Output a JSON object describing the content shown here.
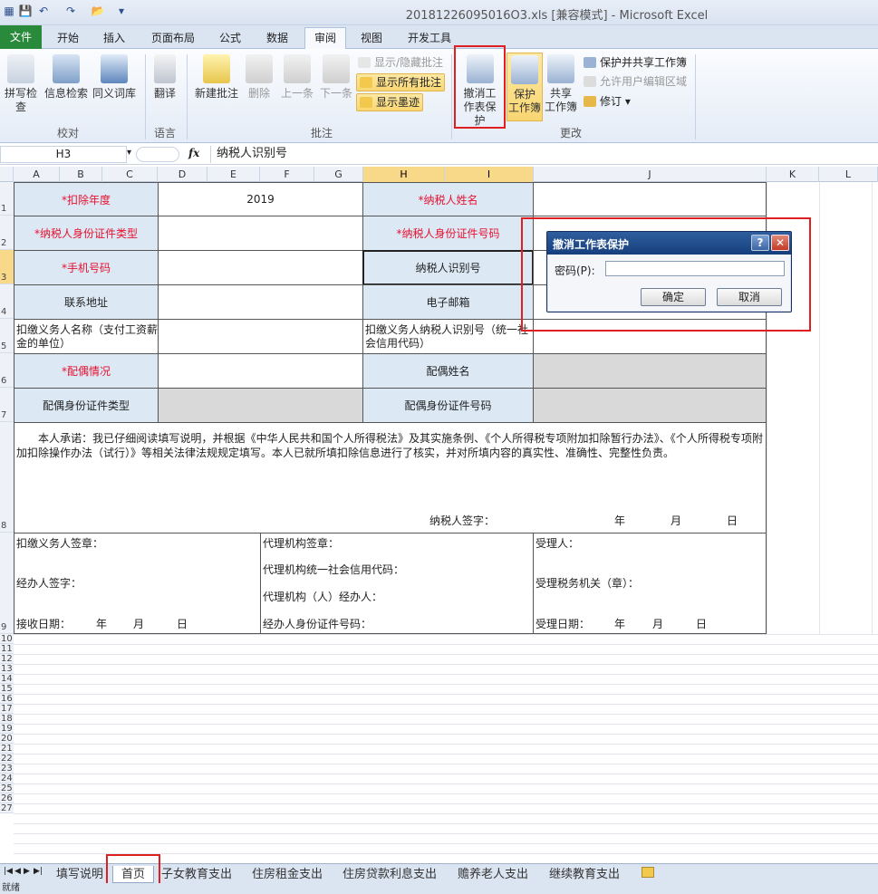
{
  "window": {
    "title": "20181226095016O3.xls  [兼容模式] - Microsoft Excel"
  },
  "menu_tabs": [
    {
      "label": "文件"
    },
    {
      "label": "开始"
    },
    {
      "label": "插入"
    },
    {
      "label": "页面布局"
    },
    {
      "label": "公式"
    },
    {
      "label": "数据"
    },
    {
      "label": "审阅"
    },
    {
      "label": "视图"
    },
    {
      "label": "开发工具"
    }
  ],
  "ribbon": {
    "proofing": {
      "spell": "拼写检查",
      "research": "信息检索",
      "thesaurus": "同义词库",
      "group": "校对"
    },
    "language": {
      "translate": "翻译",
      "group": "语言"
    },
    "comments": {
      "new": "新建批注",
      "delete": "删除",
      "prev": "上一条",
      "next": "下一条",
      "show_hide": "显示/隐藏批注",
      "show_all": "显示所有批注",
      "show_ink": "显示墨迹",
      "group": "批注"
    },
    "changes": {
      "unprotect_sheet": "撤消工作表保护",
      "protect_wb_1": "保护",
      "protect_wb_2": "工作簿",
      "share_wb_1": "共享",
      "share_wb_2": "工作簿",
      "protect_share": "保护并共享工作簿",
      "allow_edit": "允许用户编辑区域",
      "track": "修订",
      "group": "更改"
    }
  },
  "formula_bar": {
    "name_box": "H3",
    "fx": "fx",
    "formula": "纳税人识别号"
  },
  "columns": [
    "A",
    "B",
    "C",
    "D",
    "E",
    "F",
    "G",
    "H",
    "I",
    "J",
    "K",
    "L"
  ],
  "rows": [
    "1",
    "2",
    "3",
    "4",
    "5",
    "6",
    "7",
    "8",
    "9",
    "10",
    "11",
    "12",
    "13",
    "14",
    "15",
    "16",
    "17",
    "18",
    "19",
    "20",
    "21",
    "22",
    "23",
    "24",
    "25",
    "26",
    "27"
  ],
  "form": {
    "deduct_year_label": "*扣除年度",
    "deduct_year_value": "2019",
    "taxpayer_name_label": "*纳税人姓名",
    "id_type_label": "*纳税人身份证件类型",
    "id_no_label": "*纳税人身份证件号码",
    "phone_label": "*手机号码",
    "taxpayer_id_label": "纳税人识别号",
    "address_label": "联系地址",
    "email_label": "电子邮箱",
    "withholder_name_label": "扣缴义务人名称（支付工资薪金的单位）",
    "withholder_id_label": "扣缴义务人纳税人识别号（统一社会信用代码）",
    "spouse_status_label": "*配偶情况",
    "spouse_name_label": "配偶姓名",
    "spouse_id_type_label": "配偶身份证件类型",
    "spouse_id_no_label": "配偶身份证件号码",
    "commitment": "本人承诺：我已仔细阅读填写说明，并根据《中华人民共和国个人所得税法》及其实施条例、《个人所得税专项附加扣除暂行办法》、《个人所得税专项附加扣除操作办法（试行）》等相关法律法规规定填写。本人已就所填扣除信息进行了核实，并对所填内容的真实性、准确性、完整性负责。",
    "taxpayer_sign": "纳税人签字：",
    "year": "年",
    "month": "月",
    "day": "日",
    "withholder_seal": "扣缴义务人签章：",
    "handler_sign": "经办人签字：",
    "receive_date": "接收日期：",
    "agency_seal": "代理机构签章：",
    "agency_code": "代理机构统一社会信用代码：",
    "agency_handler": "代理机构（人）经办人：",
    "handler_id": "经办人身份证件号码：",
    "acceptor": "受理人：",
    "tax_office": "受理税务机关（章）：",
    "accept_date": "受理日期："
  },
  "dialog": {
    "title": "撤消工作表保护",
    "help": "?",
    "close": "✕",
    "password_label": "密码(P):",
    "password_value": "",
    "ok": "确定",
    "cancel": "取消"
  },
  "sheet_tabs": [
    "填写说明",
    "首页",
    "子女教育支出",
    "住房租金支出",
    "住房贷款利息支出",
    "赡养老人支出",
    "继续教育支出"
  ],
  "status": "就绪"
}
